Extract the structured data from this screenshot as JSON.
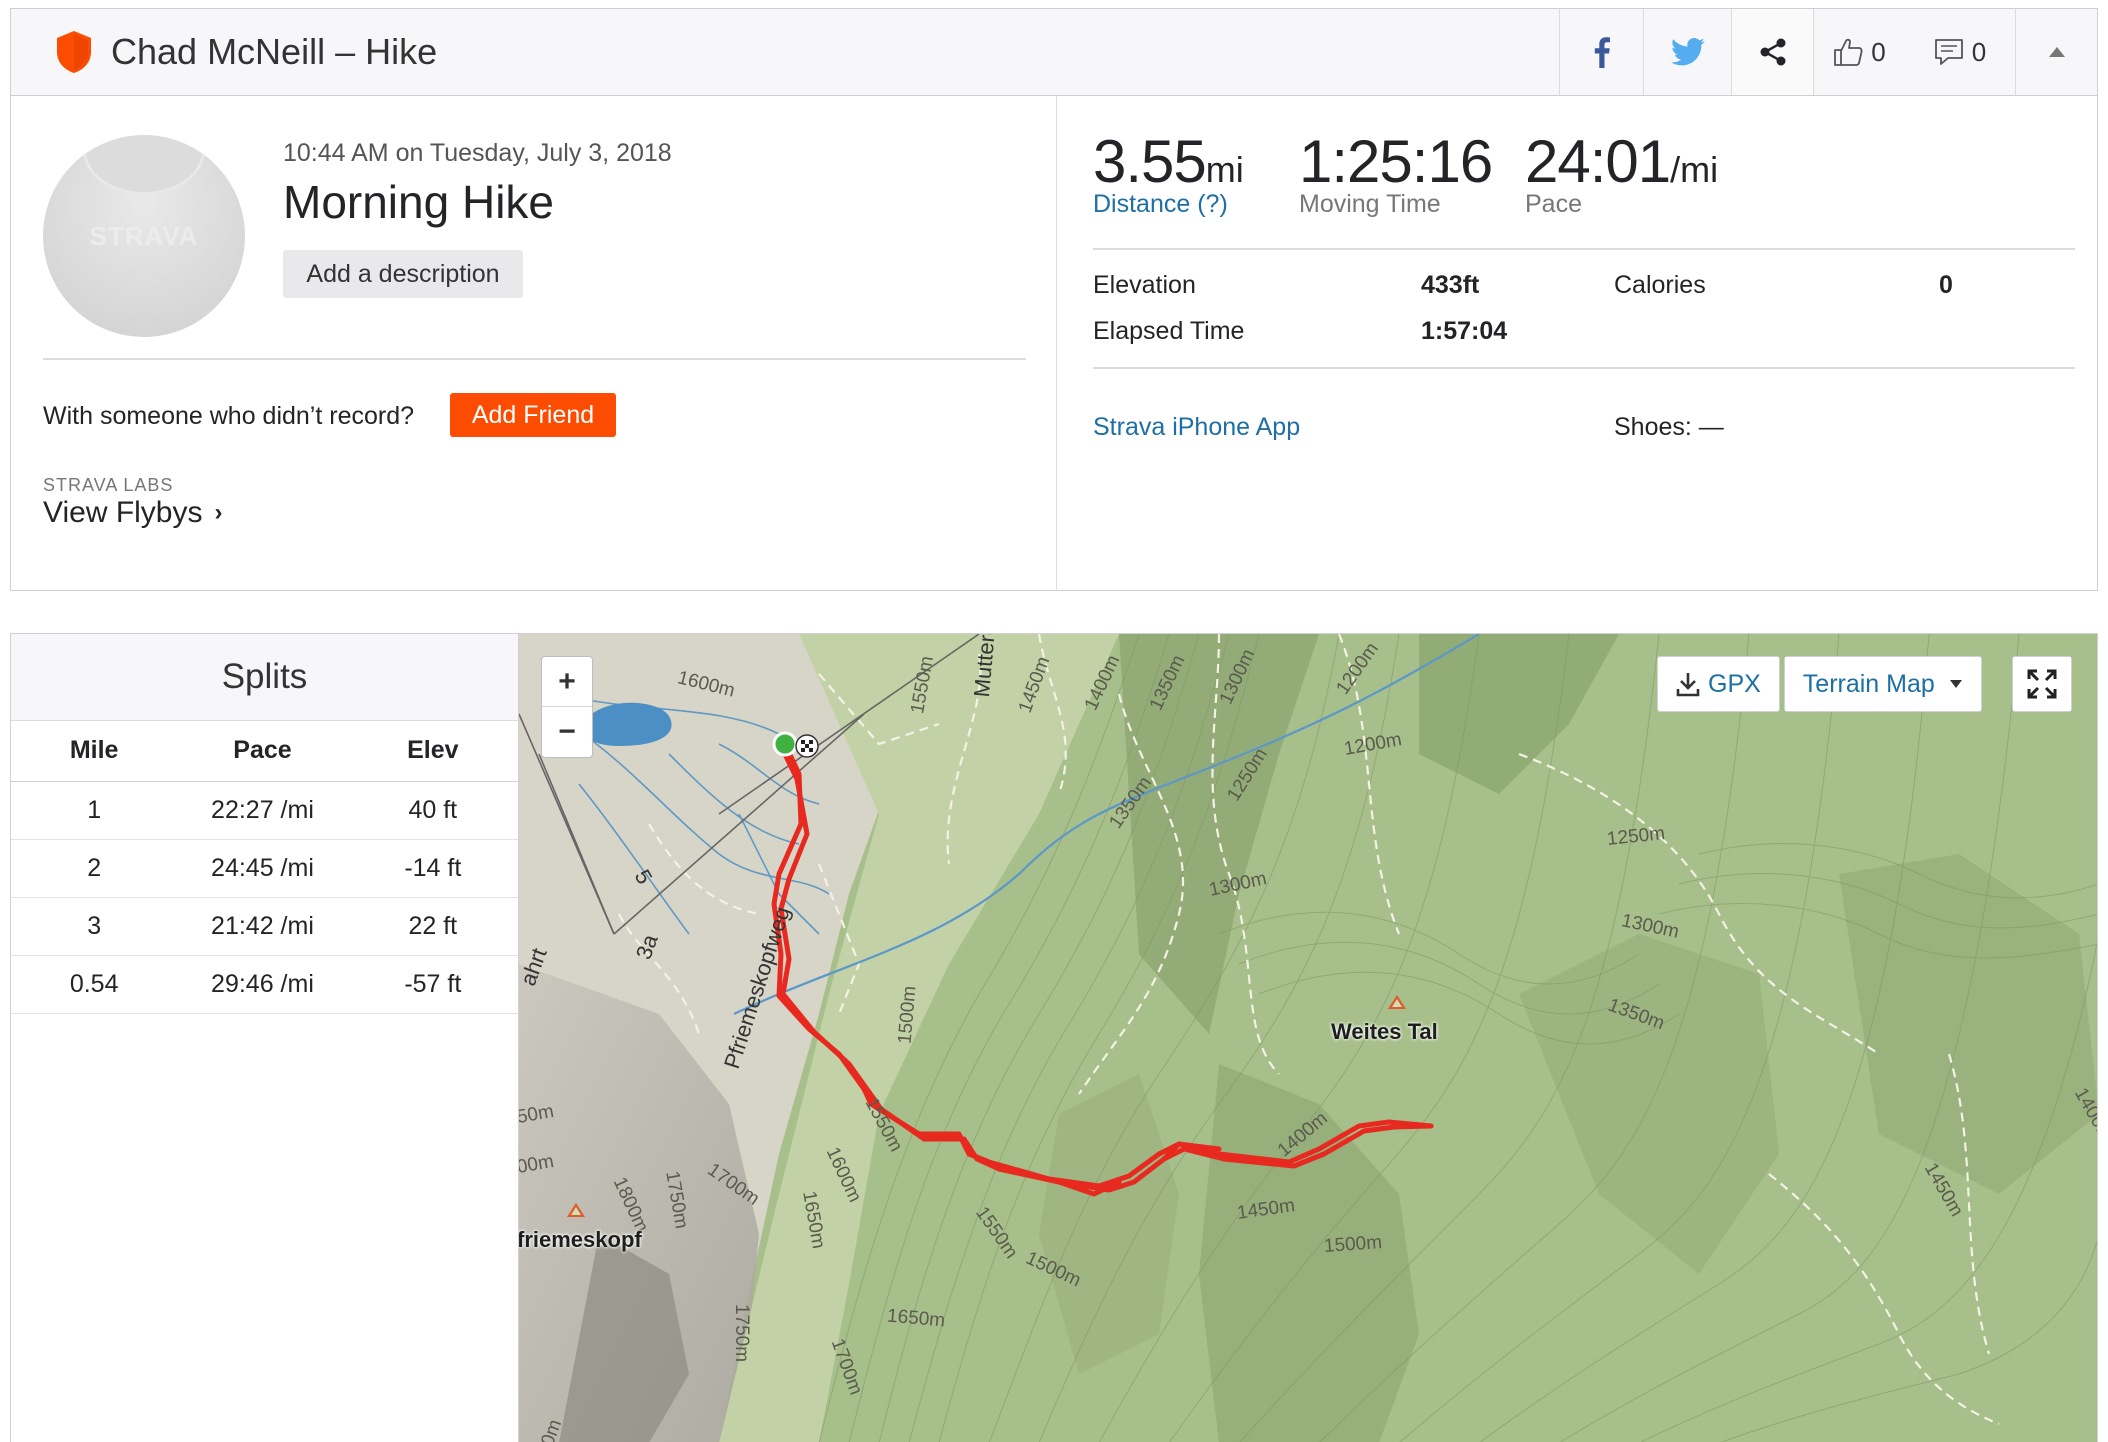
{
  "header": {
    "title": "Chad McNeill – Hike",
    "kudos_count": "0",
    "comment_count": "0",
    "icons": [
      "strava-shield-icon",
      "facebook-icon",
      "twitter-icon",
      "share-icon",
      "thumbs-up-icon",
      "comment-icon",
      "collapse-icon"
    ]
  },
  "activity": {
    "datetime": "10:44 AM on Tuesday, July 3, 2018",
    "name": "Morning Hike",
    "add_description": "Add a description",
    "avatar_logo": "STRAVA",
    "with_someone": "With someone who didn’t record?",
    "add_friend": "Add Friend",
    "labs_label": "STRAVA LABS",
    "flybys": "View Flybys"
  },
  "stats": {
    "distance": {
      "value": "3.55",
      "unit": "mi",
      "label": "Distance (?)"
    },
    "moving_time": {
      "value": "1:25:16",
      "label": "Moving Time"
    },
    "pace": {
      "value": "24:01",
      "unit": "/mi",
      "label": "Pace"
    },
    "elevation_label": "Elevation",
    "elevation_value": "433ft",
    "calories_label": "Calories",
    "calories_value": "0",
    "elapsed_label": "Elapsed Time",
    "elapsed_value": "1:57:04",
    "device": "Strava iPhone App",
    "shoes": "Shoes: —"
  },
  "splits": {
    "title": "Splits",
    "columns": [
      "Mile",
      "Pace",
      "Elev"
    ],
    "rows": [
      {
        "mile": "1",
        "pace": "22:27 /mi",
        "elev": "40 ft"
      },
      {
        "mile": "2",
        "pace": "24:45 /mi",
        "elev": "-14 ft"
      },
      {
        "mile": "3",
        "pace": "21:42 /mi",
        "elev": "22 ft"
      },
      {
        "mile": "0.54",
        "pace": "29:46 /mi",
        "elev": "-57 ft"
      }
    ]
  },
  "map": {
    "zoom_in": "+",
    "zoom_out": "−",
    "gpx": "GPX",
    "map_type": "Terrain Map",
    "route_color": "#e8291f",
    "places": [
      "Weites Tal",
      "friemeskopf"
    ],
    "road_names": [
      "Pfriemeskopfweg",
      "Mutterer",
      "5",
      "3a",
      "ahrt"
    ],
    "contour_labels": [
      "1600m",
      "1550m",
      "1450m",
      "1400m",
      "1350m",
      "1300m",
      "1200m",
      "1200m",
      "1250m",
      "1350m",
      "1300m",
      "1250m",
      "1300m",
      "1350m",
      "1500m",
      "1550m",
      "1600m",
      "1650m",
      "1700m",
      "1750m",
      "1800m",
      "1750m",
      "1700m",
      "1650m",
      "1550m",
      "1500m",
      "1450m",
      "1400m",
      "1500m",
      "1450m",
      "1400m",
      "50m",
      "00m",
      "0m"
    ]
  }
}
